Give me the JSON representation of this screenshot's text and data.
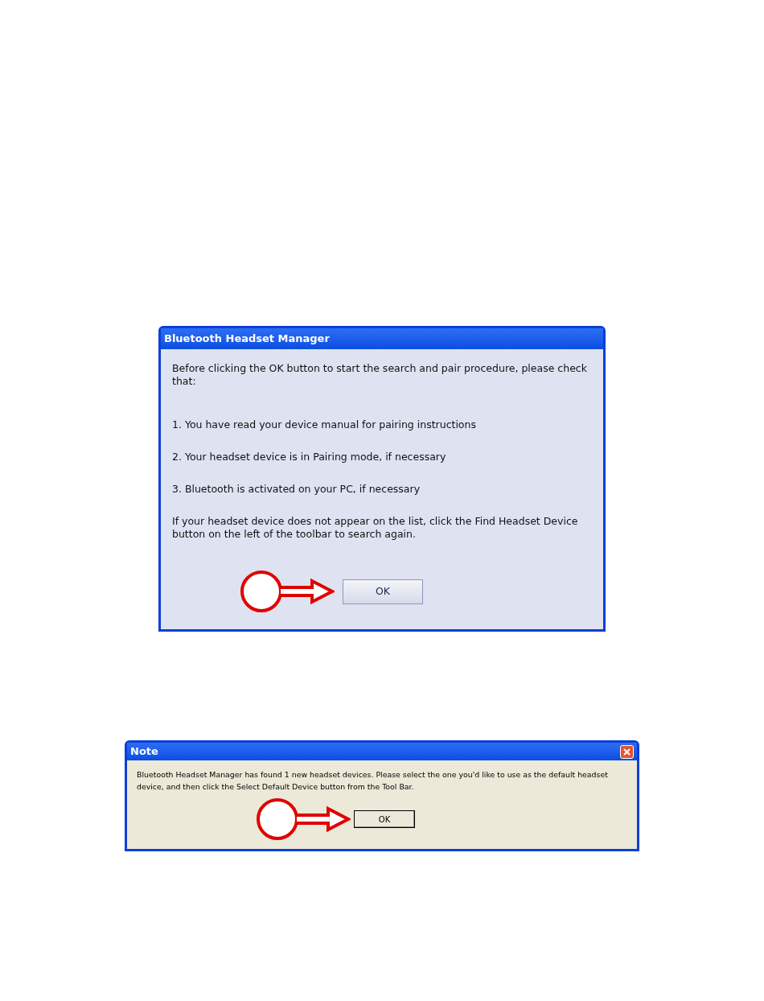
{
  "dialogs": [
    {
      "kind": "manager",
      "title": "Bluetooth Headset Manager",
      "close_button": false,
      "paragraphs": [
        "Before clicking the OK button to start the search and pair procedure, please check that:",
        "1. You have read your device manual for pairing instructions",
        "2. Your headset device is in Pairing mode, if necessary",
        "3. Bluetooth is activated on your PC, if necessary",
        "If your headset device does not appear on the list, click the Find Headset Device button on the left of the toolbar to search again."
      ],
      "button": "OK"
    },
    {
      "kind": "note",
      "title": "Note",
      "close_button": true,
      "paragraphs": [
        "Bluetooth Headset Manager has found 1 new headset devices. Please select the one you'd like to use as the default headset device, and then click the Select Default Device button from the Tool Bar."
      ],
      "button": "OK"
    }
  ]
}
